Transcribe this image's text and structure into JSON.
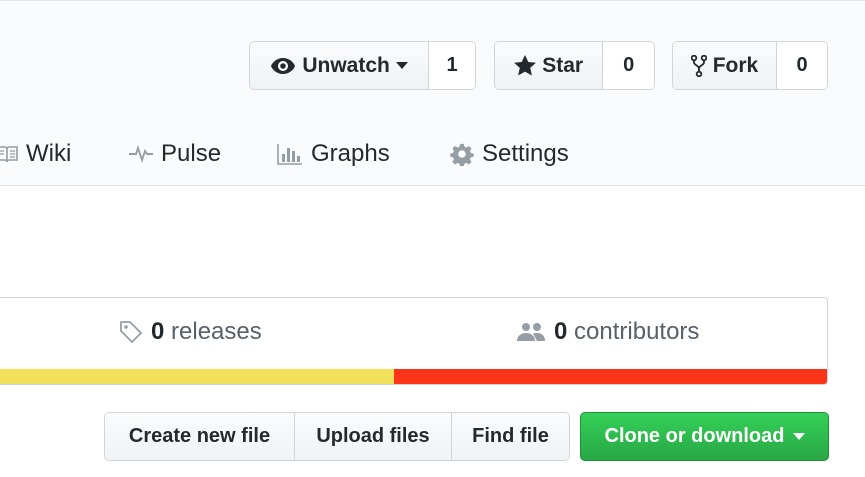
{
  "social": {
    "watch": {
      "label": "Unwatch",
      "count": "1"
    },
    "star": {
      "label": "Star",
      "count": "0"
    },
    "fork": {
      "label": "Fork",
      "count": "0"
    }
  },
  "nav": {
    "wiki": "Wiki",
    "pulse": "Pulse",
    "graphs": "Graphs",
    "settings": "Settings"
  },
  "summary": {
    "releases_count": "0",
    "releases_label": "releases",
    "contributors_count": "0",
    "contributors_label": "contributors"
  },
  "languages": [
    {
      "color": "#f1e05a",
      "fraction": 0.48
    },
    {
      "color": "#fe3419",
      "fraction": 0.52
    }
  ],
  "file_actions": {
    "create": "Create new file",
    "upload": "Upload files",
    "find": "Find file"
  },
  "clone": {
    "label": "Clone or download"
  },
  "icons": [
    "eye-icon",
    "caret-down-icon",
    "star-icon",
    "fork-icon",
    "book-icon",
    "pulse-icon",
    "graph-icon",
    "gear-icon",
    "tag-icon",
    "people-icon"
  ]
}
